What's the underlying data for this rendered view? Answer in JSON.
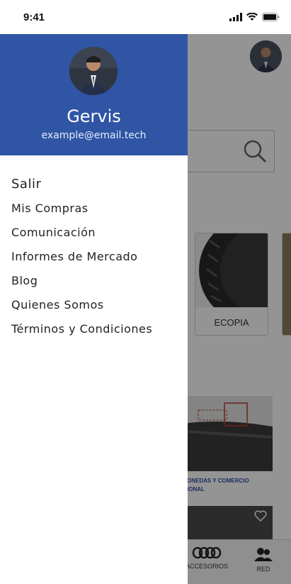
{
  "status_bar": {
    "time": "9:41"
  },
  "profile": {
    "name": "Gervis",
    "email": "example@email.tech"
  },
  "menu": {
    "items": [
      {
        "label": "Salir"
      },
      {
        "label": "Mis Compras"
      },
      {
        "label": "Comunicación"
      },
      {
        "label": "Informes de Mercado"
      },
      {
        "label": "Blog"
      },
      {
        "label": "Quienes Somos"
      },
      {
        "label": "Términos y Condiciones"
      }
    ]
  },
  "background_app": {
    "product_card_label": "ECOPIA",
    "news_caption_line1": "ONEDAS Y COMERCIO",
    "news_caption_line2": "IONAL",
    "bottom_nav": [
      {
        "label": "ACCESORIOS",
        "icon": "tires-icon"
      },
      {
        "label": "RED",
        "icon": "network-users-icon"
      }
    ]
  },
  "colors": {
    "drawer_header": "#2f55a4",
    "news_caption": "#2f4fa0"
  }
}
